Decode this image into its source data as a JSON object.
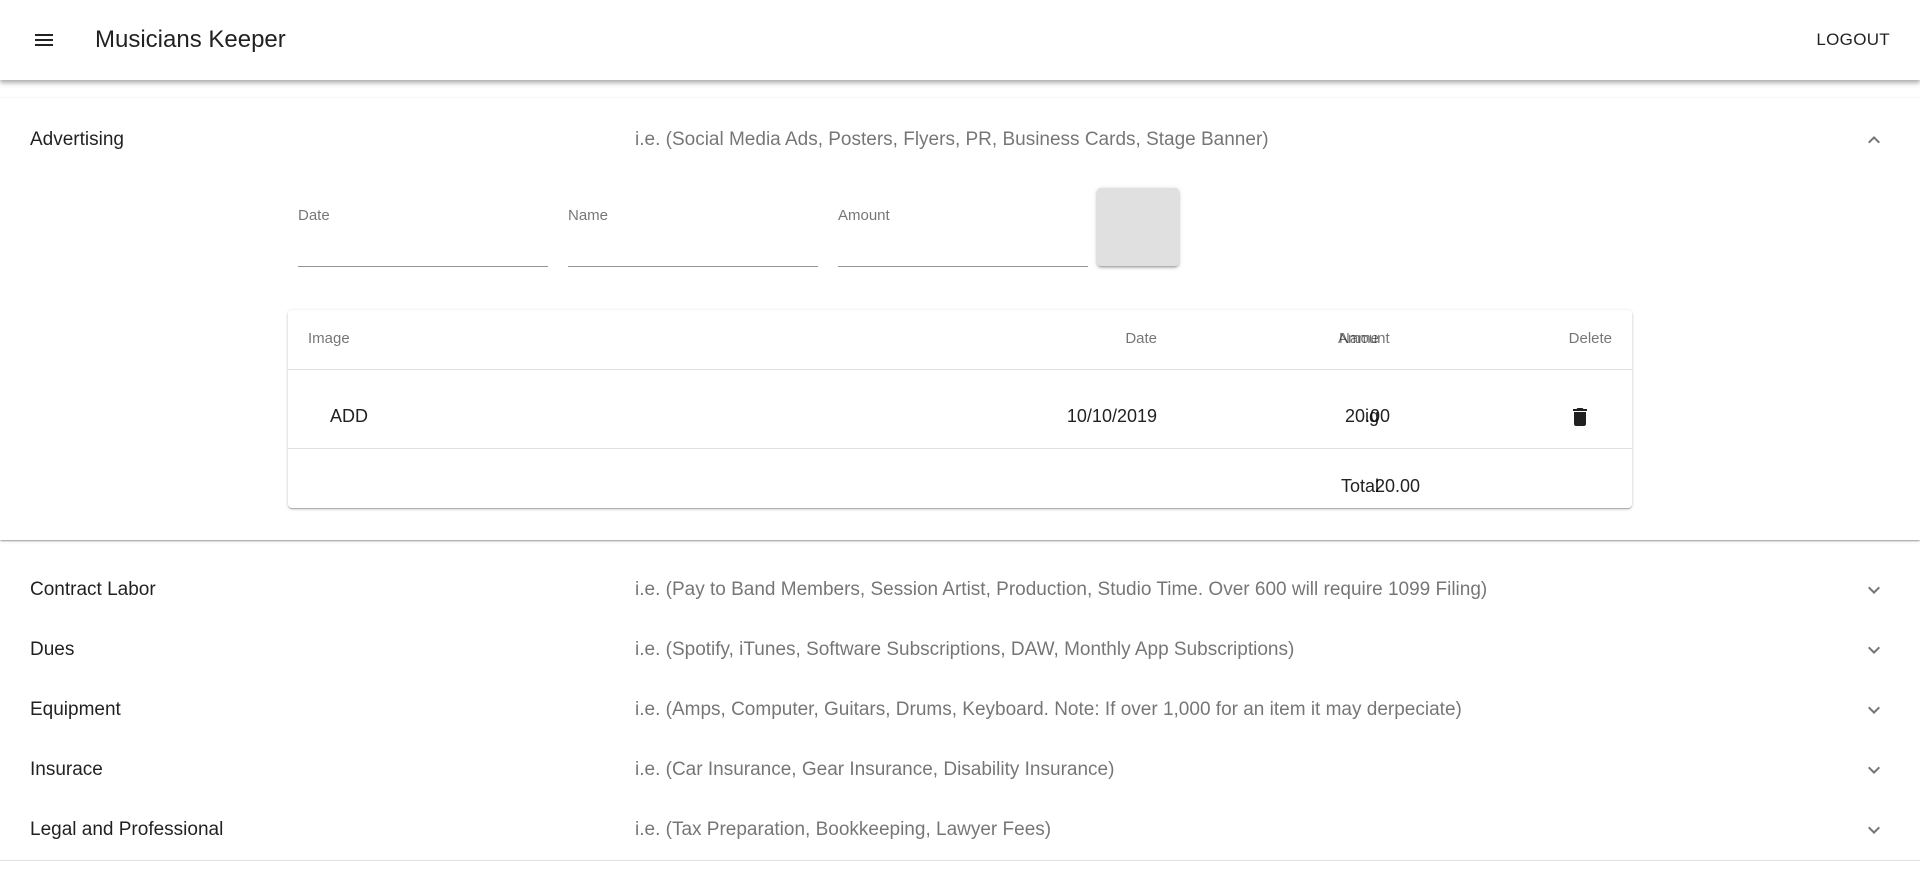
{
  "app": {
    "title": "Musicians Keeper",
    "logout_label": "LOGOUT",
    "menu_icon": "menu-icon"
  },
  "expanded_panel": {
    "heading": "Advertising",
    "description": "i.e. (Social Media Ads, Posters, Flyers, PR, Business Cards, Stage Banner)",
    "chevron_icon": "chevron-up-icon",
    "form": {
      "date_label": "Date",
      "date_value": "",
      "name_label": "Name",
      "name_value": "",
      "amount_label": "Amount",
      "amount_value": ""
    },
    "table": {
      "headers": {
        "image": "Image",
        "date": "Date",
        "name": "Name",
        "amount": "Amount",
        "delete": "Delete"
      },
      "rows": [
        {
          "image": "ADD",
          "date": "10/10/2019",
          "name": "ig",
          "amount": "20.00",
          "delete_icon": "trash-icon"
        }
      ],
      "total_label": "Total",
      "total_value": "20.00"
    }
  },
  "collapsed_panels": [
    {
      "heading": "Contract Labor",
      "description": "i.e. (Pay to Band Members, Session Artist, Production, Studio Time. Over 600 will require 1099 Filing)"
    },
    {
      "heading": "Dues",
      "description": "i.e. (Spotify, iTunes, Software Subscriptions, DAW, Monthly App Subscriptions)"
    },
    {
      "heading": "Equipment",
      "description": "i.e. (Amps, Computer, Guitars, Drums, Keyboard. Note: If over 1,000 for an item it may derpeciate)"
    },
    {
      "heading": "Insurace",
      "description": "i.e. (Car Insurance, Gear Insurance, Disability Insurance)"
    },
    {
      "heading": "Legal and Professional",
      "description": "i.e. (Tax Preparation, Bookkeeping, Lawyer Fees)"
    }
  ]
}
